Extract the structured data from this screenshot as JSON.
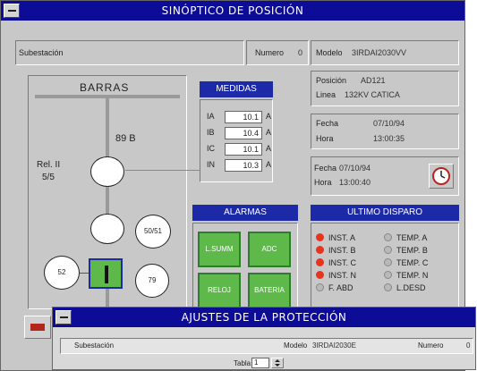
{
  "main_window": {
    "title": "SINÓPTICO DE POSICIÓN",
    "subestacion_label": "Subestación",
    "numero_label": "Numero",
    "numero_value": "0",
    "modelo_label": "Modelo",
    "modelo_value": "3IRDAI2030VV",
    "barras_label": "BARRAS",
    "label_89b": "89 B",
    "rel_label": "Rel. II",
    "rel_value": "5/5",
    "circle_5051": "50/51",
    "circle_52": "52",
    "circle_79": "79",
    "medidas": {
      "title": "MEDIDAS",
      "rows": [
        {
          "label": "IA",
          "value": "10.1",
          "unit": "A"
        },
        {
          "label": "IB",
          "value": "10.4",
          "unit": "A"
        },
        {
          "label": "IC",
          "value": "10.1",
          "unit": "A"
        },
        {
          "label": "IN",
          "value": "10.3",
          "unit": "A"
        }
      ]
    },
    "info": {
      "posicion_label": "Posición",
      "posicion_value": "AD121",
      "linea_label": "Linea",
      "linea_value": "132KV CATICA",
      "fecha_label": "Fecha",
      "fecha_value": "07/10/94",
      "hora_label": "Hora",
      "hora_value": "13:00:35"
    },
    "disparo_time": {
      "fecha_label": "Fecha",
      "fecha_value": "07/10/94",
      "hora_label": "Hora",
      "hora_value": "13:00:40"
    },
    "alarmas": {
      "title": "ALARMAS",
      "buttons": [
        "L.SUMM",
        "ADC",
        "RELOJ",
        "BATERIA"
      ]
    },
    "ultimo_disparo": {
      "title": "ULTIMO DISPARO",
      "col1": [
        {
          "label": "INST. A",
          "color": "#e8331e"
        },
        {
          "label": "INST. B",
          "color": "#e8331e"
        },
        {
          "label": "INST. C",
          "color": "#e8331e"
        },
        {
          "label": "INST. N",
          "color": "#e8331e"
        },
        {
          "label": "F. ABD",
          "color": "#b9b9b9"
        }
      ],
      "col2": [
        {
          "label": "TEMP. A",
          "color": "#b9b9b9"
        },
        {
          "label": "TEMP. B",
          "color": "#b9b9b9"
        },
        {
          "label": "TEMP. C",
          "color": "#b9b9b9"
        },
        {
          "label": "TEMP. N",
          "color": "#b9b9b9"
        },
        {
          "label": "L.DESD",
          "color": "#b9b9b9"
        }
      ]
    }
  },
  "second_window": {
    "title": "AJUSTES DE LA PROTECCIÓN",
    "subestacion_label": "Subestación",
    "modelo_label": "Modelo",
    "modelo_value": "3IRDAI2030E",
    "numero_label": "Numero",
    "numero_value": "0",
    "tabla_label": "Tabla",
    "tabla_value": "1"
  },
  "colors": {
    "titlebar": "#0c0c96",
    "header_blue": "#1c2aa8",
    "green_button": "#5fb84a",
    "alarm_red": "#e8331e"
  },
  "icons": [
    "window-menu-icon",
    "clock-icon",
    "stepper-arrow-icon"
  ]
}
